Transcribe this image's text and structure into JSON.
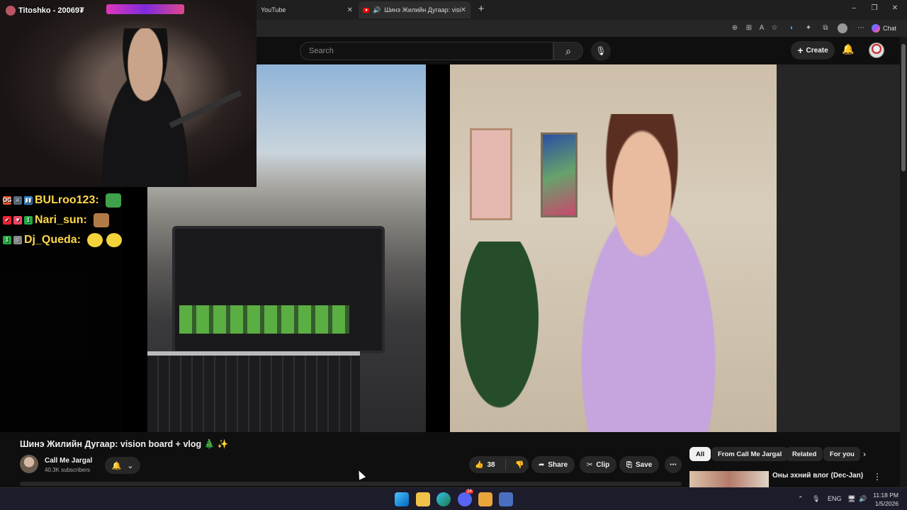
{
  "browser": {
    "tabs": [
      {
        "title": "YouTube",
        "close": "✕"
      },
      {
        "title": "Шинэ Жилийн Дугаар: vision",
        "close": "✕"
      }
    ],
    "new_tab": "+",
    "window_controls": {
      "minimize": "–",
      "restore": "❐",
      "close": "✕"
    },
    "toolbar_icons": [
      "translate-icon",
      "extensions-icon",
      "read-aloud-icon",
      "favorite-icon",
      "bing-icon",
      "puzzle-icon",
      "collections-icon",
      "profile-icon",
      "menu-icon"
    ],
    "chat_label": "Chat"
  },
  "youtube_header": {
    "search_placeholder": "Search",
    "create_label": "Create"
  },
  "overlay": {
    "streamer_name": "Titoshko - 20069₮",
    "chat": [
      {
        "badges": [
          "OG",
          "⚔",
          "▮▮"
        ],
        "username": "BULroo123:",
        "emote_color": "#3fa14a"
      },
      {
        "badges": [
          "✔",
          "♥",
          "1"
        ],
        "username": "Nari_sun:",
        "emote_color": "#b07a46"
      },
      {
        "badges": [
          "1",
          "☺"
        ],
        "username": "Dj_Queda:",
        "emote_color": "#f4d23a"
      }
    ]
  },
  "video": {
    "title": "Шинэ Жилийн Дугаар: vision board + vlog 🎄 ✨",
    "channel": "Call Me Jargal",
    "subscribers": "40.3K subscribers",
    "likes": "38",
    "share_label": "Share",
    "clip_label": "Clip",
    "save_label": "Save",
    "more_label": "⋯"
  },
  "chips": [
    "All",
    "From Call Me Jargal",
    "Related",
    "For you"
  ],
  "recommendation": {
    "title": "Оны эхний влог (Dec-Jan)"
  },
  "taskbar": {
    "language": "ENG",
    "time": "11:18 PM",
    "date": "1/5/2026",
    "discord_badge": "24"
  },
  "colors": {
    "accent_red": "#ff0000",
    "bg": "#0f0f0f",
    "chat_name": "#ffd84a"
  }
}
